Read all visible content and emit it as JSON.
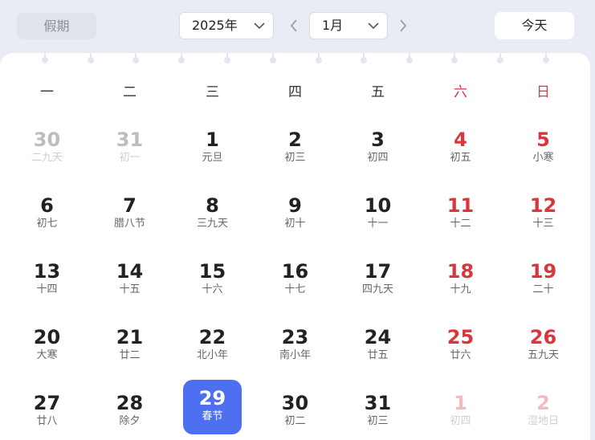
{
  "toolbar": {
    "holiday_label": "假期",
    "year_value": "2025年",
    "month_value": "1月",
    "today_label": "今天"
  },
  "colors": {
    "accent": "#4d6ff0",
    "weekend": "#d9363e"
  },
  "weekdays": [
    "一",
    "二",
    "三",
    "四",
    "五",
    "六",
    "日"
  ],
  "weeks": [
    [
      {
        "d": "30",
        "l": "二九天",
        "m": true
      },
      {
        "d": "31",
        "l": "初一",
        "m": true
      },
      {
        "d": "1",
        "l": "元旦"
      },
      {
        "d": "2",
        "l": "初三"
      },
      {
        "d": "3",
        "l": "初四"
      },
      {
        "d": "4",
        "l": "初五"
      },
      {
        "d": "5",
        "l": "小寒"
      }
    ],
    [
      {
        "d": "6",
        "l": "初七"
      },
      {
        "d": "7",
        "l": "腊八节"
      },
      {
        "d": "8",
        "l": "三九天"
      },
      {
        "d": "9",
        "l": "初十"
      },
      {
        "d": "10",
        "l": "十一"
      },
      {
        "d": "11",
        "l": "十二"
      },
      {
        "d": "12",
        "l": "十三"
      }
    ],
    [
      {
        "d": "13",
        "l": "十四"
      },
      {
        "d": "14",
        "l": "十五"
      },
      {
        "d": "15",
        "l": "十六"
      },
      {
        "d": "16",
        "l": "十七"
      },
      {
        "d": "17",
        "l": "四九天"
      },
      {
        "d": "18",
        "l": "十九"
      },
      {
        "d": "19",
        "l": "二十"
      }
    ],
    [
      {
        "d": "20",
        "l": "大寒"
      },
      {
        "d": "21",
        "l": "廿二"
      },
      {
        "d": "22",
        "l": "北小年"
      },
      {
        "d": "23",
        "l": "南小年"
      },
      {
        "d": "24",
        "l": "廿五"
      },
      {
        "d": "25",
        "l": "廿六"
      },
      {
        "d": "26",
        "l": "五九天"
      }
    ],
    [
      {
        "d": "27",
        "l": "廿八"
      },
      {
        "d": "28",
        "l": "除夕"
      },
      {
        "d": "29",
        "l": "春节",
        "s": true
      },
      {
        "d": "30",
        "l": "初二"
      },
      {
        "d": "31",
        "l": "初三"
      },
      {
        "d": "1",
        "l": "初四",
        "m": true
      },
      {
        "d": "2",
        "l": "湿地日",
        "m": true
      }
    ]
  ]
}
